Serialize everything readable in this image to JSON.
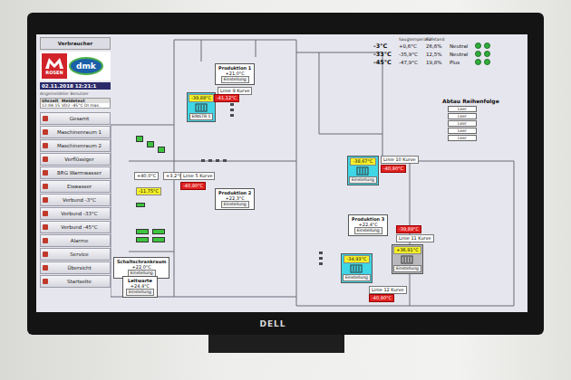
{
  "monitor": {
    "brand": "DELL"
  },
  "sidebar": {
    "header_button": "Verbraucher",
    "logo": {
      "left": "ROSEN",
      "right": "dmk"
    },
    "datetime": "02.11.2018 12:21:1",
    "user_label": "Angemeldeter Benutzer",
    "alarms": {
      "columns": [
        "Uhrzeit",
        "Meldetext"
      ],
      "rows": [
        [
          "12:04:15",
          "VD2 -45°C DI max."
        ]
      ]
    },
    "items": [
      {
        "label": "Gesamt",
        "selected": false
      },
      {
        "label": "Maschinenraum 1",
        "selected": false
      },
      {
        "label": "Maschinenraum 2",
        "selected": false
      },
      {
        "label": "Verflüssiger",
        "selected": false
      },
      {
        "label": "BRG Warmwasser",
        "selected": false
      },
      {
        "label": "Eiswasser",
        "selected": false
      },
      {
        "label": "Verbund -3°C",
        "selected": false
      },
      {
        "label": "Verbund -33°C",
        "selected": false
      },
      {
        "label": "Verbund -45°C",
        "selected": false
      },
      {
        "label": "Alarme",
        "selected": false
      },
      {
        "label": "Service",
        "selected": false
      },
      {
        "label": "Übersicht",
        "selected": false
      },
      {
        "label": "Startseite",
        "selected": false
      }
    ]
  },
  "rooms": [
    {
      "name": "Produktion 1",
      "temp": "+21,0°C",
      "button": "Einstellung"
    },
    {
      "name": "Produktion 2",
      "temp": "+22,3°C",
      "button": "Einstellung"
    },
    {
      "name": "Produktion 3",
      "temp": "+22,4°C",
      "button": "Einstellung"
    },
    {
      "name": "Schaltschrankraum",
      "temp": "+22,0°C",
      "button": "Einstellung"
    },
    {
      "name": "Leitwarte",
      "temp": "+24,4°C",
      "button": "Einstellung"
    }
  ],
  "units": [
    {
      "label": "EINSTR 1",
      "reading": "-39,88°C",
      "active": true
    },
    {
      "label": "Einstellung",
      "reading": "-38,67°C",
      "active": true
    },
    {
      "label": "Einstellung",
      "reading": "+36,91°C",
      "active": false
    },
    {
      "label": "Einstellung",
      "reading": "-34,93°C",
      "active": true
    }
  ],
  "tags": [
    {
      "text": "Linie 9 Kurve",
      "kind": "plain"
    },
    {
      "text": "-41,12°C",
      "kind": "red"
    },
    {
      "text": "+40,0°C",
      "kind": "plain"
    },
    {
      "text": "+3,2°C",
      "kind": "plain"
    },
    {
      "text": "Linie 5 Kurve",
      "kind": "plain"
    },
    {
      "text": "-11,75°C",
      "kind": "yellow"
    },
    {
      "text": "-40,90°C",
      "kind": "red"
    },
    {
      "text": "Linie 10 Kurve",
      "kind": "plain"
    },
    {
      "text": "-40,90°C",
      "kind": "red"
    },
    {
      "text": "-39,89°C",
      "kind": "red"
    },
    {
      "text": "Linie 11 Kurve",
      "kind": "plain"
    },
    {
      "text": "Linie 12 Kurve",
      "kind": "plain"
    },
    {
      "text": "-40,90°C",
      "kind": "red"
    }
  ],
  "indicators": [
    {
      "on": true
    },
    {
      "on": true
    },
    {
      "on": true
    },
    {
      "on": true
    },
    {
      "on": true
    },
    {
      "on": true
    },
    {
      "on": true
    },
    {
      "on": true
    }
  ],
  "suction": {
    "columns": [
      "Saugtemperatur",
      "Füllstand"
    ],
    "rows": [
      {
        "setpoint": "-3°C",
        "actual": "+0,6°C",
        "level": "26,6%",
        "mode": "Neutral",
        "color": "#2fae3a"
      },
      {
        "setpoint": "-33°C",
        "actual": "-35,9°C",
        "level": "12,5%",
        "mode": "Neutral",
        "color": "#2fae3a"
      },
      {
        "setpoint": "-45°C",
        "actual": "-47,9°C",
        "level": "19,8%",
        "mode": "Plus",
        "color": "#2fae3a"
      }
    ]
  },
  "defrost": {
    "title": "Abtau Reihenfolge",
    "slots": [
      "Leer",
      "Leer",
      "Leer",
      "Leer",
      "Leer"
    ]
  }
}
